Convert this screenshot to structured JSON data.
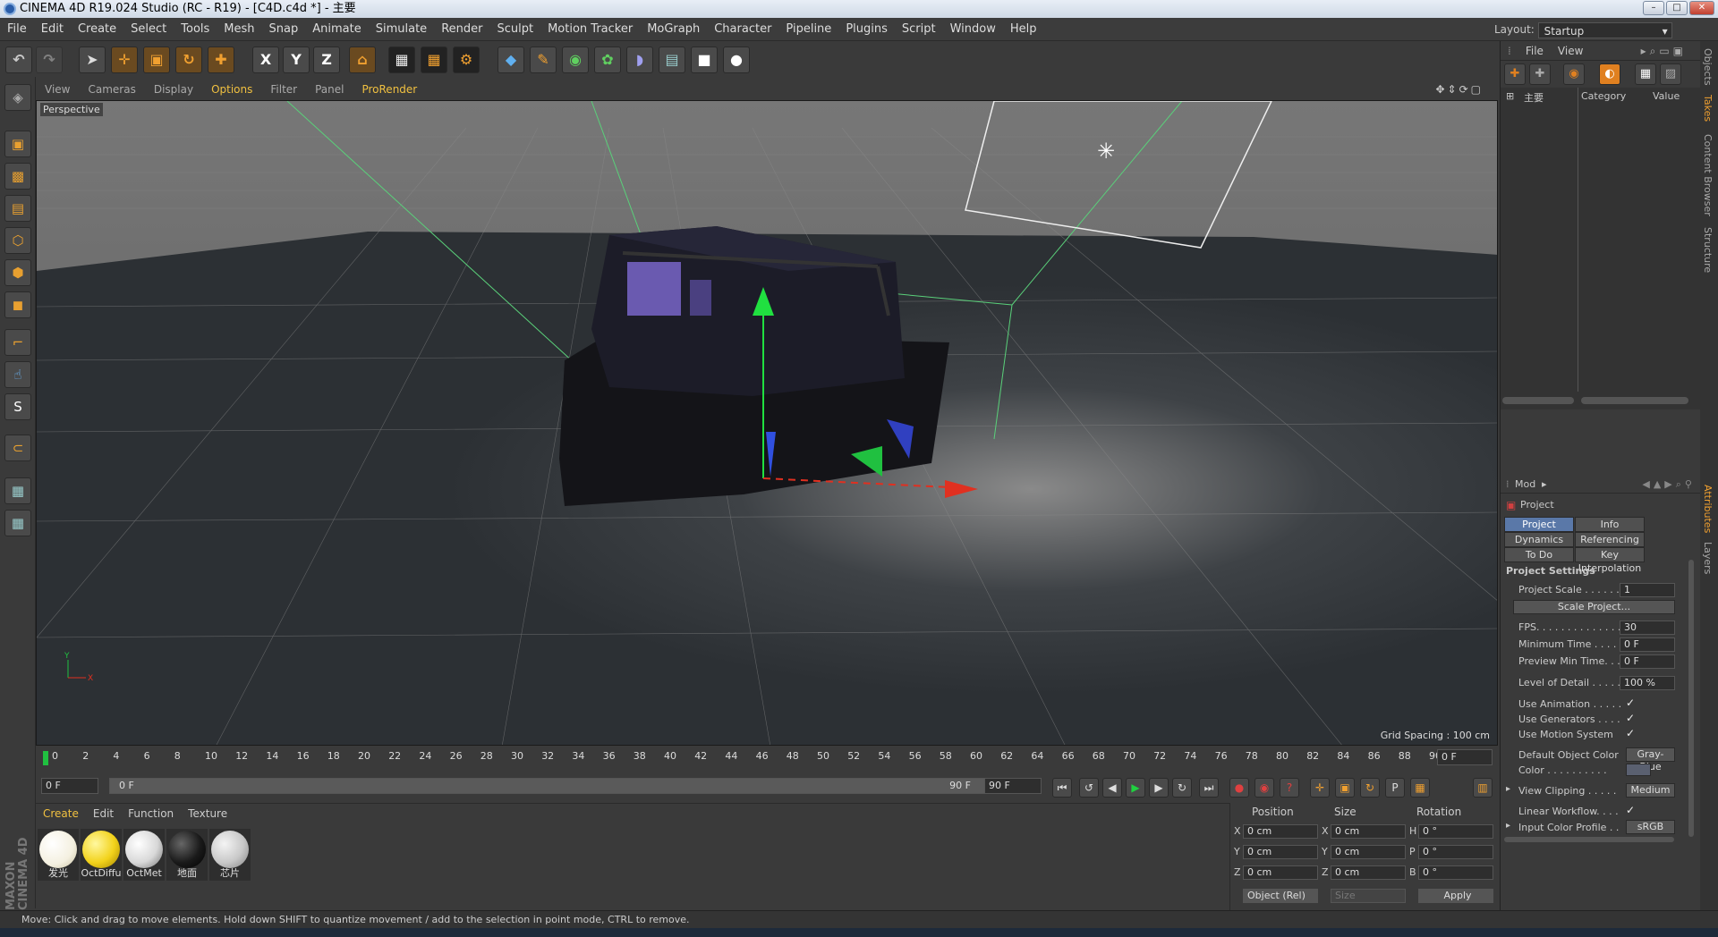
{
  "window": {
    "title": "CINEMA 4D R19.024 Studio (RC - R19) - [C4D.c4d *] - 主要"
  },
  "menubar": {
    "items": [
      "File",
      "Edit",
      "Create",
      "Select",
      "Tools",
      "Mesh",
      "Snap",
      "Animate",
      "Simulate",
      "Render",
      "Sculpt",
      "Motion Tracker",
      "MoGraph",
      "Character",
      "Pipeline",
      "Plugins",
      "Script",
      "Window",
      "Help"
    ]
  },
  "layout": {
    "label": "Layout:",
    "value": "Startup"
  },
  "viewport": {
    "menu": [
      "View",
      "Cameras",
      "Display",
      "Options",
      "Filter",
      "Panel",
      "ProRender"
    ],
    "camera_label": "Perspective",
    "grid_spacing": "Grid Spacing : 100 cm"
  },
  "timeline": {
    "ticks": [
      "0",
      "2",
      "4",
      "6",
      "8",
      "10",
      "12",
      "14",
      "16",
      "18",
      "20",
      "22",
      "24",
      "26",
      "28",
      "30",
      "32",
      "34",
      "36",
      "38",
      "40",
      "42",
      "44",
      "46",
      "48",
      "50",
      "52",
      "54",
      "56",
      "58",
      "60",
      "62",
      "64",
      "66",
      "68",
      "70",
      "72",
      "74",
      "76",
      "78",
      "80",
      "82",
      "84",
      "86",
      "88",
      "90"
    ],
    "current_frame": "0 F",
    "start": "0 F",
    "range_start": "0 F",
    "range_end": "90 F",
    "end": "90 F"
  },
  "materials": {
    "menu": [
      "Create",
      "Edit",
      "Function",
      "Texture"
    ],
    "items": [
      {
        "name": "发光",
        "color": "#f4f0e0"
      },
      {
        "name": "OctDiffu",
        "color": "#f2d21a"
      },
      {
        "name": "OctMet",
        "color": "#d8d8d8"
      },
      {
        "name": "地面",
        "color": "#1a1a1a"
      },
      {
        "name": "芯片",
        "color": "#c8c8c8"
      }
    ]
  },
  "coordinates": {
    "headers": [
      "Position",
      "Size",
      "Rotation"
    ],
    "rows": [
      {
        "pl": "X",
        "pv": "0 cm",
        "sl": "X",
        "sv": "0 cm",
        "rl": "H",
        "rv": "0 °"
      },
      {
        "pl": "Y",
        "pv": "0 cm",
        "sl": "Y",
        "sv": "0 cm",
        "rl": "P",
        "rv": "0 °"
      },
      {
        "pl": "Z",
        "pv": "0 cm",
        "sl": "Z",
        "sv": "0 cm",
        "rl": "B",
        "rv": "0 °"
      }
    ],
    "mode": "Object (Rel)",
    "size_mode": "Size",
    "apply": "Apply"
  },
  "status": "Move: Click and drag to move elements. Hold down SHIFT to quantize movement / add to the selection in point mode, CTRL to remove.",
  "object_manager": {
    "menu": [
      "File",
      "View"
    ],
    "columns": [
      "主要",
      "Category",
      "Value"
    ]
  },
  "attributes": {
    "menu": "Mod",
    "object": "Project",
    "tabs": [
      "Project Settings",
      "Info",
      "Dynamics",
      "Referencing",
      "To Do",
      "Key Interpolation"
    ],
    "section": "Project Settings",
    "project_scale_label": "Project Scale . . . . . .",
    "project_scale": "1",
    "scale_project_btn": "Scale Project...",
    "fps_label": "FPS. . . . . . . . . . . . . . .",
    "fps": "30",
    "min_time_label": "Minimum Time . . . .",
    "min_time": "0 F",
    "preview_min_label": "Preview Min Time. . .",
    "preview_min": "0 F",
    "lod_label": "Level of Detail . . . . .",
    "lod": "100 %",
    "use_animation": "Use Animation . . . . .",
    "use_generators": "Use Generators . . . .",
    "use_motion": "Use Motion System",
    "default_color_label": "Default Object Color",
    "default_color": "Gray-Blue",
    "color_label": "Color . . . . . . . . . .",
    "view_clipping_label": "View Clipping . . . . .",
    "view_clipping": "Medium",
    "linear_workflow": "Linear Workflow. . . .",
    "input_profile_label": "Input Color Profile . .",
    "input_profile": "sRGB"
  },
  "side_tabs": [
    "Objects",
    "Takes",
    "Content Browser",
    "Structure",
    "Attributes",
    "Layers"
  ],
  "brand": "MAXON CINEMA 4D"
}
